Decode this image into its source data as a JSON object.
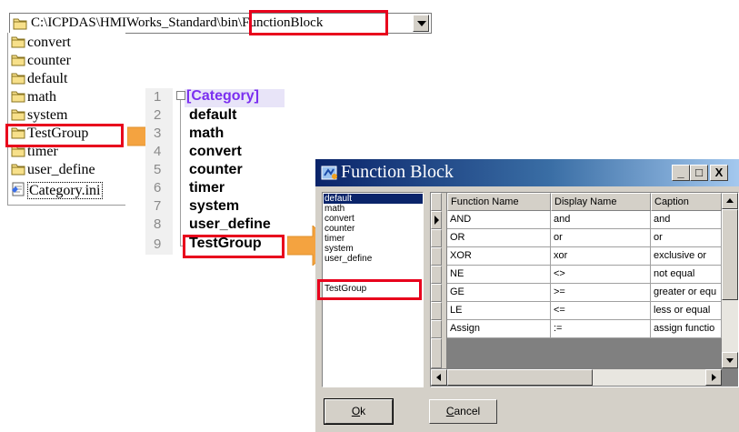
{
  "explorer": {
    "path_prefix": "C:\\ICPDAS\\HMIWorks_Standard\\",
    "path_highlight": "bin\\FunctionBlock",
    "folders": [
      "convert",
      "counter",
      "default",
      "math",
      "system",
      "TestGroup",
      "timer",
      "user_define"
    ],
    "file": "Category.ini"
  },
  "editor": {
    "line_numbers": [
      "1",
      "2",
      "3",
      "4",
      "5",
      "6",
      "7",
      "8",
      "9"
    ],
    "lines": [
      "[Category]",
      "default",
      "math",
      "convert",
      "counter",
      "timer",
      "system",
      "user_define",
      "TestGroup"
    ]
  },
  "dialog": {
    "title": "Function Block",
    "window_buttons": [
      "_",
      "□",
      "X"
    ],
    "categories": [
      "default",
      "math",
      "convert",
      "counter",
      "timer",
      "system",
      "user_define",
      "TestGroup"
    ],
    "selected_category": "default",
    "columns": [
      "Function Name",
      "Display Name",
      "Caption"
    ],
    "rows": [
      {
        "name": "AND",
        "display": "and",
        "caption": "and"
      },
      {
        "name": "OR",
        "display": "or",
        "caption": "or"
      },
      {
        "name": "XOR",
        "display": "xor",
        "caption": "exclusive or"
      },
      {
        "name": "NE",
        "display": "<>",
        "caption": "not equal"
      },
      {
        "name": "GE",
        "display": ">=",
        "caption": "greater or equ"
      },
      {
        "name": "LE",
        "display": "<=",
        "caption": "less or equal"
      },
      {
        "name": "Assign",
        "display": ":=",
        "caption": "assign functio"
      }
    ],
    "ok_label": "Ok",
    "ok_mnemonic": "O",
    "ok_rest": "k",
    "cancel_mnemonic": "C",
    "cancel_rest": "ancel"
  },
  "colors": {
    "highlight_red": "#e8001c",
    "arrow_orange": "#f4a340",
    "title_blue": "#0a246a",
    "category_purple": "#7b2ff0"
  },
  "icons": {
    "folder": "folder-icon",
    "ini_file": "ini-file-icon",
    "arrow": "right-arrow-icon",
    "app": "function-block-app-icon"
  }
}
